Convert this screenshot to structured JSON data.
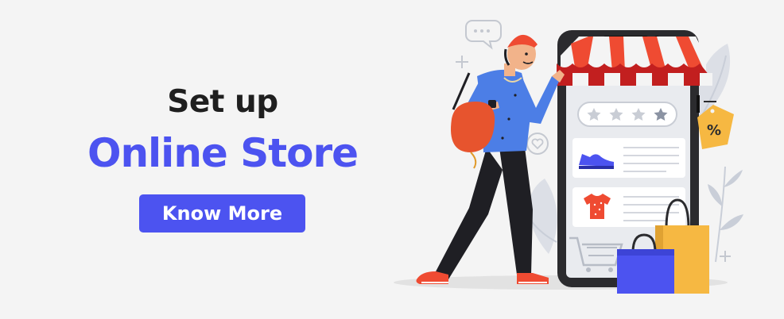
{
  "headline": {
    "line1": "Set up",
    "line2": "Online Store"
  },
  "cta": {
    "label": "Know More"
  },
  "colors": {
    "accent": "#4c53f0",
    "heading": "#1f1f1f",
    "background": "#f4f4f4"
  },
  "illustration": {
    "icons": [
      "chat-bubble-icon",
      "heart-icon",
      "plus-icon",
      "percent-tag-icon",
      "star-icon",
      "sneaker-icon",
      "shirt-icon",
      "cart-icon",
      "shopping-bag-icon"
    ],
    "rating": {
      "filled": 3,
      "total": 4
    },
    "tag_text": "%"
  }
}
